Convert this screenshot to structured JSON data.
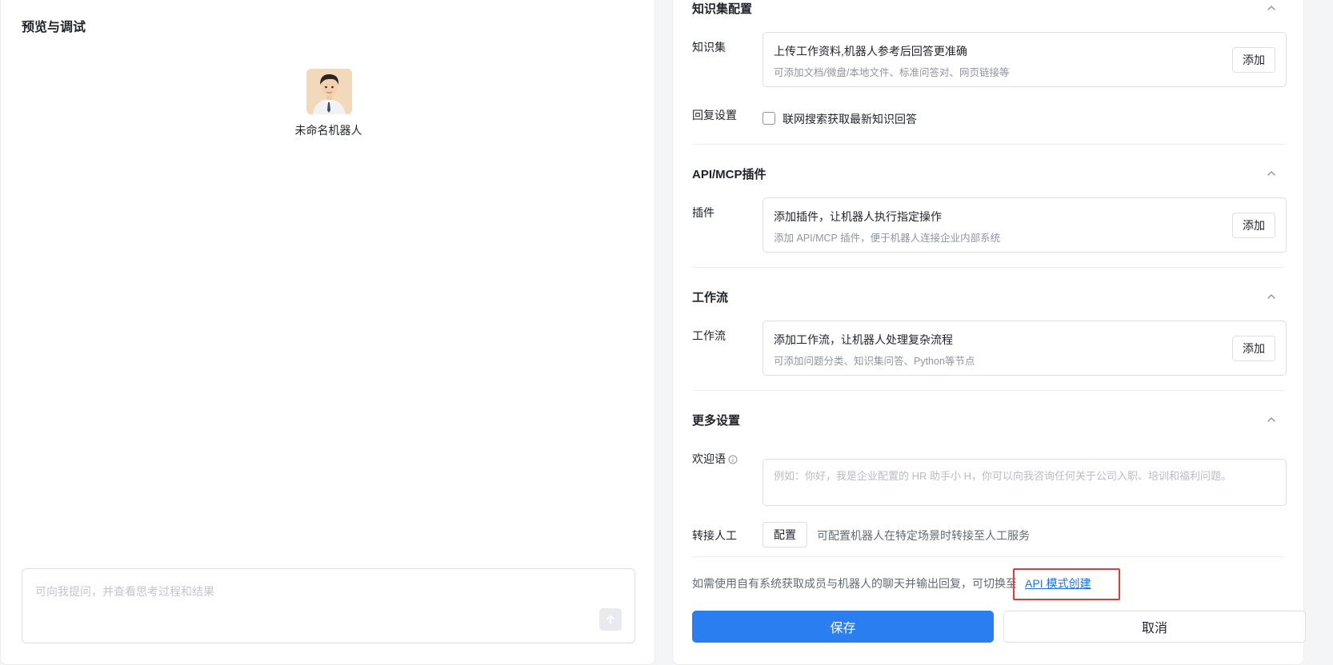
{
  "preview": {
    "title": "预览与调试",
    "bot_name": "未命名机器人",
    "chat_placeholder": "可向我提问，并查看思考过程和结果"
  },
  "knowledge": {
    "section_title": "知识集配置",
    "row_label": "知识集",
    "card_title": "上传工作资料,机器人参考后回答更准确",
    "card_sub": "可添加文档/微盘/本地文件、标准问答对、网页链接等",
    "add_label": "添加",
    "reply_label": "回复设置",
    "web_search_label": "联网搜索获取最新知识回答"
  },
  "plugins": {
    "section_title": "API/MCP插件",
    "row_label": "插件",
    "card_title": "添加插件，让机器人执行指定操作",
    "card_sub": "添加 API/MCP 插件，便于机器人连接企业内部系统",
    "add_label": "添加"
  },
  "workflow": {
    "section_title": "工作流",
    "row_label": "工作流",
    "card_title": "添加工作流，让机器人处理复杂流程",
    "card_sub": "可添加问题分类、知识集问答、Python等节点",
    "add_label": "添加"
  },
  "more": {
    "section_title": "更多设置",
    "welcome_label": "欢迎语",
    "welcome_placeholder": "例如：你好，我是企业配置的 HR 助手小 H，你可以向我咨询任何关于公司入职、培训和福利问题。",
    "handoff_label": "转接人工",
    "config_label": "配置",
    "handoff_desc": "可配置机器人在特定场景时转接至人工服务"
  },
  "footer": {
    "note": "如需使用自有系统获取成员与机器人的聊天并输出回复，可切换至",
    "api_link": "API 模式创建",
    "save_label": "保存",
    "cancel_label": "取消"
  },
  "colors": {
    "primary": "#2b7ef0",
    "link": "#1f6fe5",
    "highlight": "#e53935"
  }
}
